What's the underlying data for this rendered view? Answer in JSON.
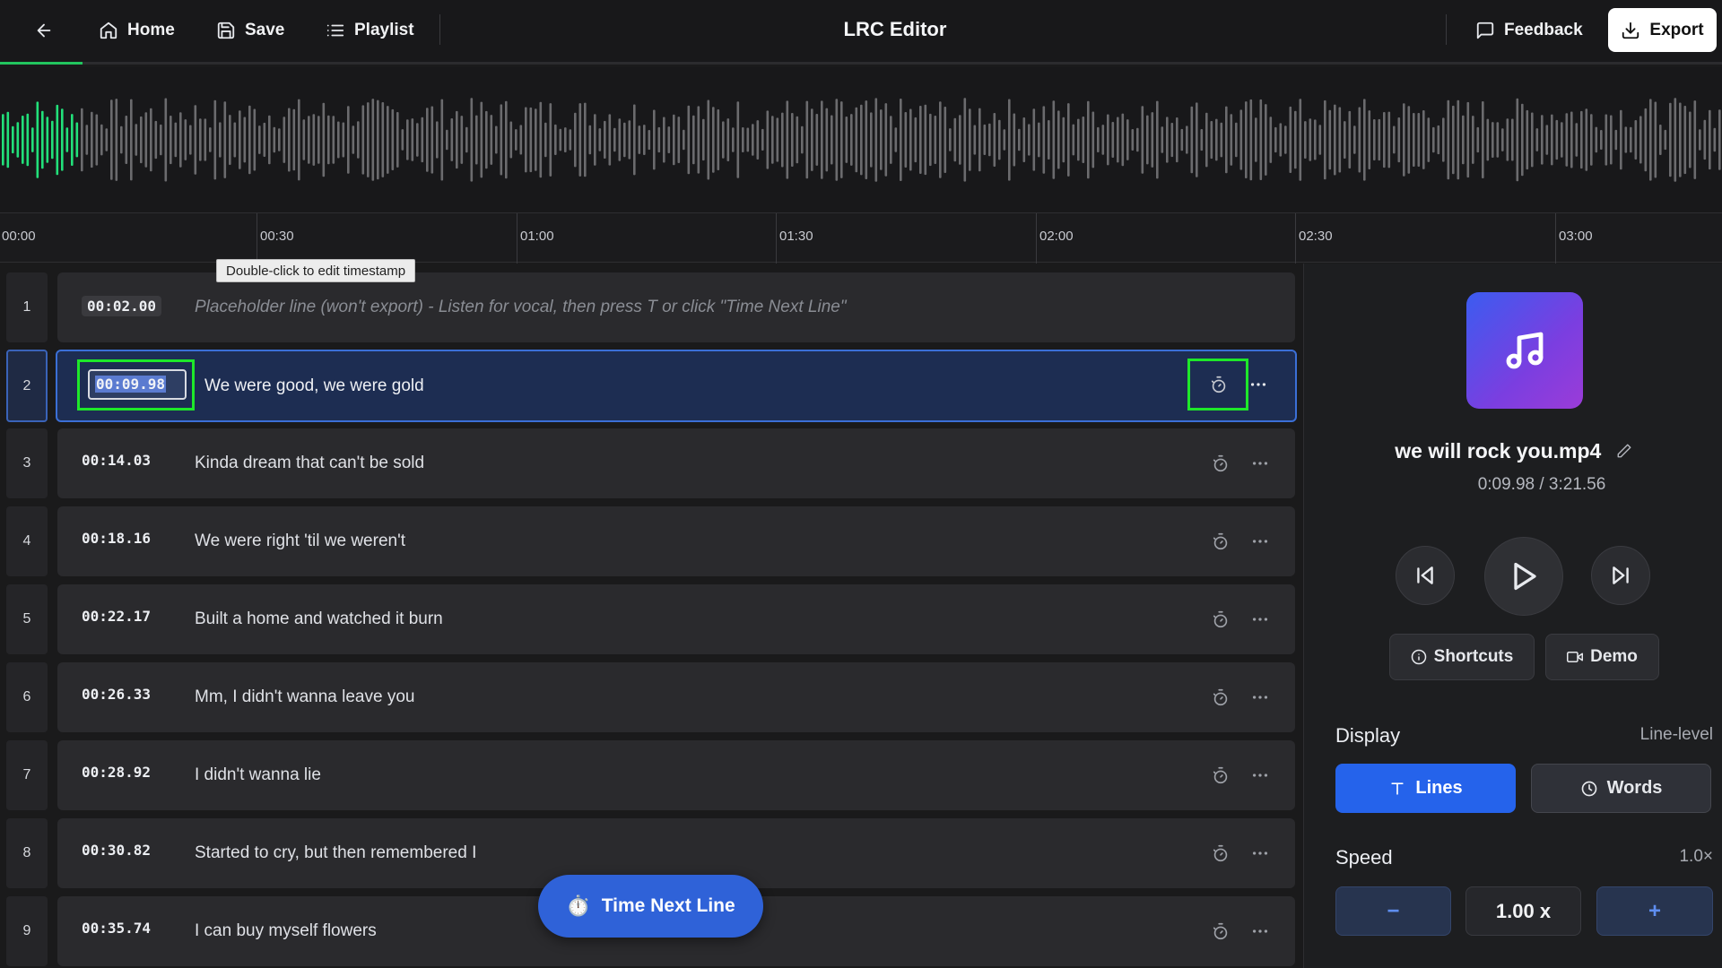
{
  "app": {
    "title": "LRC Editor"
  },
  "toolbar": {
    "home_label": "Home",
    "save_label": "Save",
    "playlist_label": "Playlist",
    "feedback_label": "Feedback",
    "export_label": "Export"
  },
  "playback": {
    "progress_fraction": 0.048
  },
  "timeline": {
    "ticks": [
      "00:00",
      "00:30",
      "01:00",
      "01:30",
      "02:00",
      "02:30",
      "03:00"
    ]
  },
  "tooltip": {
    "text": "Double-click to edit timestamp"
  },
  "lines": [
    {
      "num": "1",
      "timestamp": "00:02.00",
      "text": "Placeholder line (won't export) - Listen for vocal, then press T or click \"Time Next Line\""
    },
    {
      "num": "2",
      "timestamp": "00:09.98",
      "text": "We were good, we were gold"
    },
    {
      "num": "3",
      "timestamp": "00:14.03",
      "text": "Kinda dream that can't be sold"
    },
    {
      "num": "4",
      "timestamp": "00:18.16",
      "text": "We were right 'til we weren't"
    },
    {
      "num": "5",
      "timestamp": "00:22.17",
      "text": "Built a home and watched it burn"
    },
    {
      "num": "6",
      "timestamp": "00:26.33",
      "text": "Mm, I didn't wanna leave you"
    },
    {
      "num": "7",
      "timestamp": "00:28.92",
      "text": "I didn't wanna lie"
    },
    {
      "num": "8",
      "timestamp": "00:30.82",
      "text": "Started to cry, but then remembered I"
    },
    {
      "num": "9",
      "timestamp": "00:35.74",
      "text": "I can buy myself flowers"
    }
  ],
  "fab": {
    "label": "Time Next Line",
    "icon": "⏱️"
  },
  "panel": {
    "filename": "we will rock you.mp4",
    "timecode": "0:09.98 / 3:21.56",
    "shortcuts_label": "Shortcuts",
    "demo_label": "Demo",
    "display_label": "Display",
    "display_mode": "Line-level",
    "lines_label": "Lines",
    "words_label": "Words",
    "speed_label": "Speed",
    "speed_meta": "1.0×",
    "speed_minus": "−",
    "speed_value": "1.00 x",
    "speed_plus": "+"
  },
  "colors": {
    "accent": "#2563eb",
    "waveform_played": "#22e07a",
    "waveform_unplayed": "#6b6b6e",
    "highlight_box": "#1ee82a"
  },
  "icons": {
    "back": "arrow-left-icon",
    "home": "home-icon",
    "save": "save-icon",
    "playlist": "list-icon",
    "feedback": "message-icon",
    "export": "download-icon",
    "row_timer": "timer-icon",
    "row_more": "more-icon"
  }
}
